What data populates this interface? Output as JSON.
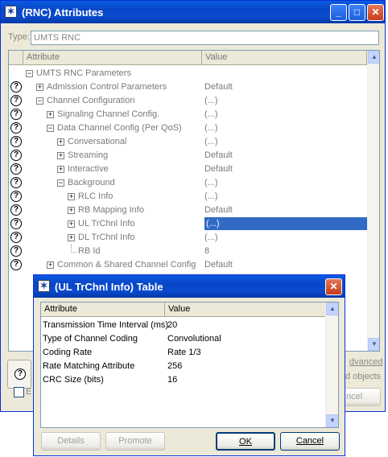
{
  "main_window": {
    "title": "(RNC) Attributes",
    "type_label": "Type:",
    "type_value": "UMTS RNC",
    "col_attribute": "Attribute",
    "col_value": "Value",
    "rows": [
      {
        "label": "UMTS RNC Parameters",
        "value": "",
        "toggle": "⊟",
        "help": false
      },
      {
        "label": "Admission Control Parameters",
        "value": "Default",
        "toggle": "⊞",
        "help": true
      },
      {
        "label": "Channel Configuration",
        "value": "(...)",
        "toggle": "⊟",
        "help": true
      },
      {
        "label": "Signaling Channel Config.",
        "value": "(...)",
        "toggle": "⊞",
        "help": true
      },
      {
        "label": "Data Channel Config (Per QoS)",
        "value": "(...)",
        "toggle": "⊟",
        "help": true
      },
      {
        "label": "Conversational",
        "value": "(...)",
        "toggle": "⊞",
        "help": true
      },
      {
        "label": "Streaming",
        "value": "Default",
        "toggle": "⊞",
        "help": true
      },
      {
        "label": "Interactive",
        "value": "Default",
        "toggle": "⊞",
        "help": true
      },
      {
        "label": "Background",
        "value": "(...)",
        "toggle": "⊟",
        "help": true
      },
      {
        "label": "RLC Info",
        "value": "(...)",
        "toggle": "⊞",
        "help": true
      },
      {
        "label": "RB Mapping Info",
        "value": "Default",
        "toggle": "⊞",
        "help": true
      },
      {
        "label": "UL TrChnl Info",
        "value": "(...)",
        "toggle": "⊞",
        "help": true
      },
      {
        "label": "DL TrChnl Info",
        "value": "(...)",
        "toggle": "⊞",
        "help": true
      },
      {
        "label": "RB Id",
        "value": "8",
        "toggle": "",
        "help": true
      },
      {
        "label": "Common & Shared Channel Config",
        "value": "Default",
        "toggle": "⊞",
        "help": true
      }
    ],
    "advanced_label": "dvanced",
    "objects_label": "d objects",
    "cancel_partial": "ncel",
    "ex_label": "E"
  },
  "dialog": {
    "title": "(UL TrChnl Info) Table",
    "col_attribute": "Attribute",
    "col_value": "Value",
    "rows": [
      {
        "attribute": "Transmission Time Interval (ms)",
        "value": "20"
      },
      {
        "attribute": "Type of Channel Coding",
        "value": "Convolutional"
      },
      {
        "attribute": "Coding Rate",
        "value": "Rate 1/3"
      },
      {
        "attribute": "Rate Matching Attribute",
        "value": "256"
      },
      {
        "attribute": "CRC Size (bits)",
        "value": "16"
      }
    ],
    "details_label": "Details",
    "promote_label": "Promote",
    "ok_label": "OK",
    "cancel_label": "Cancel"
  },
  "icons": {
    "help": "?",
    "minimize": "_",
    "maximize": "□",
    "close": "✕",
    "app": "✶"
  }
}
